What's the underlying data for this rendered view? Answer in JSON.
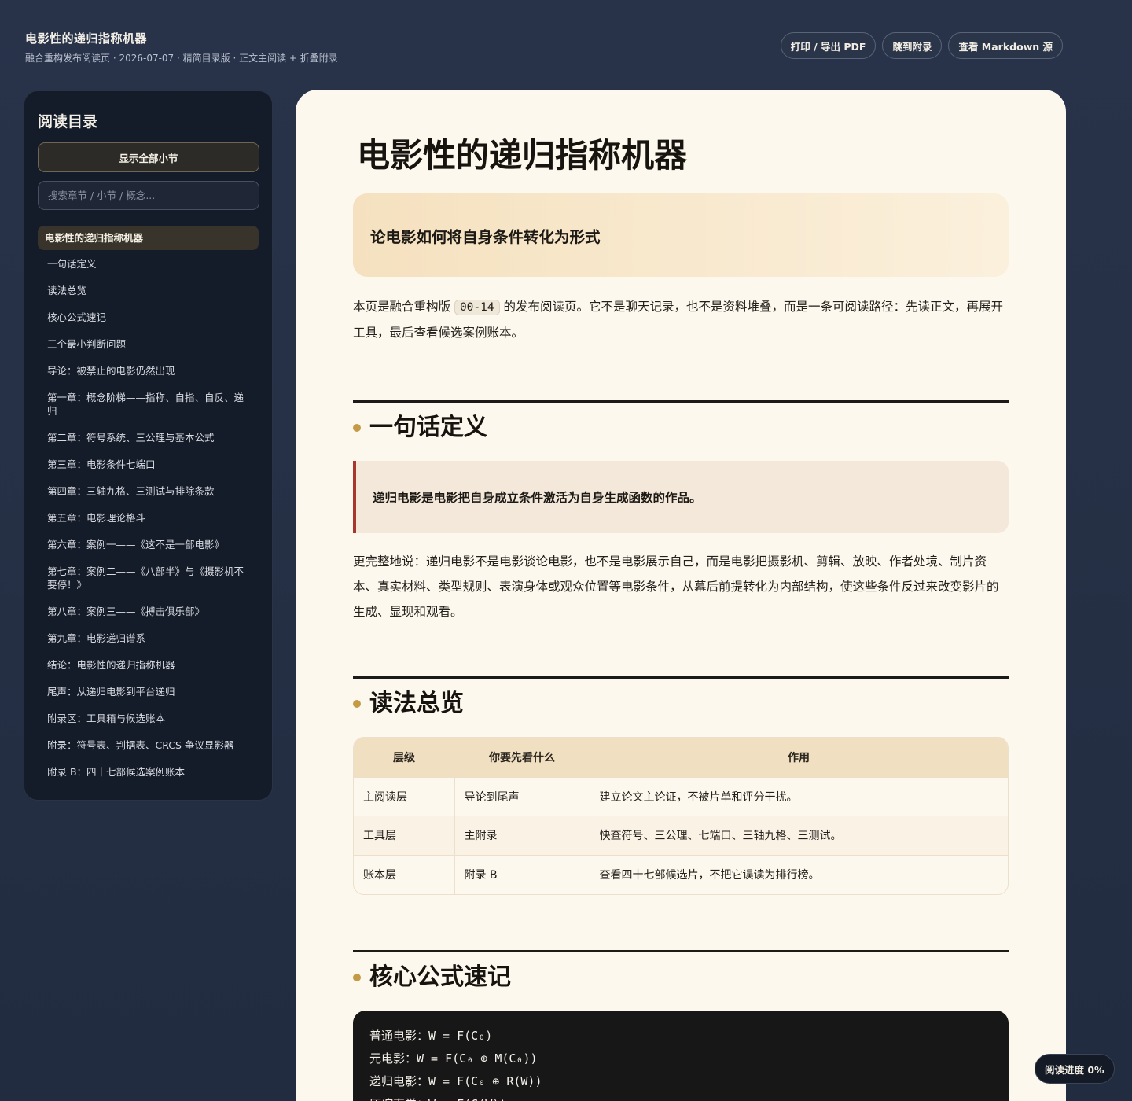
{
  "header": {
    "title": "电影性的递归指称机器",
    "subtitle": "融合重构发布阅读页 · 2026-07-07 · 精简目录版 · 正文主阅读 + 折叠附录",
    "actions": [
      "打印 / 导出 PDF",
      "跳到附录",
      "查看 Markdown 源"
    ]
  },
  "sidebar": {
    "title": "阅读目录",
    "toggle_label": "显示全部小节",
    "search_placeholder": "搜索章节 / 小节 / 概念...",
    "items": [
      "电影性的递归指称机器",
      "一句话定义",
      "读法总览",
      "核心公式速记",
      "三个最小判断问题",
      "导论：被禁止的电影仍然出现",
      "第一章：概念阶梯——指称、自指、自反、递归",
      "第二章：符号系统、三公理与基本公式",
      "第三章：电影条件七端口",
      "第四章：三轴九格、三测试与排除条款",
      "第五章：电影理论格斗",
      "第六章：案例一——《这不是一部电影》",
      "第七章：案例二——《八部半》与《摄影机不要停！》",
      "第八章：案例三——《搏击俱乐部》",
      "第九章：电影递归谱系",
      "结论：电影性的递归指称机器",
      "尾声：从递归电影到平台递归",
      "附录区：工具箱与候选账本",
      "附录：符号表、判据表、CRCS 争议显影器",
      "附录 B：四十七部候选案例账本"
    ],
    "active_index": 0
  },
  "doc": {
    "title": "电影性的递归指称机器",
    "subtitle": "论电影如何将自身条件转化为形式",
    "intro_before": "本页是融合重构版 ",
    "intro_code": "00-14",
    "intro_after": " 的发布阅读页。它不是聊天记录，也不是资料堆叠，而是一条可阅读路径：先读正文，再展开工具，最后查看候选案例账本。",
    "sections": {
      "definition": {
        "title": "一句话定义",
        "quote": "递归电影是电影把自身成立条件激活为自身生成函数的作品。",
        "body": "更完整地说：递归电影不是电影谈论电影，也不是电影展示自己，而是电影把摄影机、剪辑、放映、作者处境、制片资本、真实材料、类型规则、表演身体或观众位置等电影条件，从幕后前提转化为内部结构，使这些条件反过来改变影片的生成、显现和观看。"
      },
      "overview": {
        "title": "读法总览",
        "headers": [
          "层级",
          "你要先看什么",
          "作用"
        ],
        "rows": [
          [
            "主阅读层",
            "导论到尾声",
            "建立论文主论证，不被片单和评分干扰。"
          ],
          [
            "工具层",
            "主附录",
            "快查符号、三公理、七端口、三轴九格、三测试。"
          ],
          [
            "账本层",
            "附录 B",
            "查看四十七部候选片，不把它误读为排行榜。"
          ]
        ]
      },
      "formulas": {
        "title": "核心公式速记",
        "lines": [
          "普通电影：W = F(C₀)",
          "元电影：W = F(C₀ ⊕ M(C₀))",
          "递归电影：W = F(C₀ ⊕ R(W))",
          "压缩直觉：W = F(C(W))"
        ]
      }
    }
  },
  "progress": {
    "label": "阅读进度 0%"
  },
  "colors": {
    "page_bg": "#28334a",
    "sidebar_bg": "#151c29",
    "paper": "#fdf8ee",
    "accent_gold": "#c49a47",
    "accent_red": "#a8362c"
  }
}
